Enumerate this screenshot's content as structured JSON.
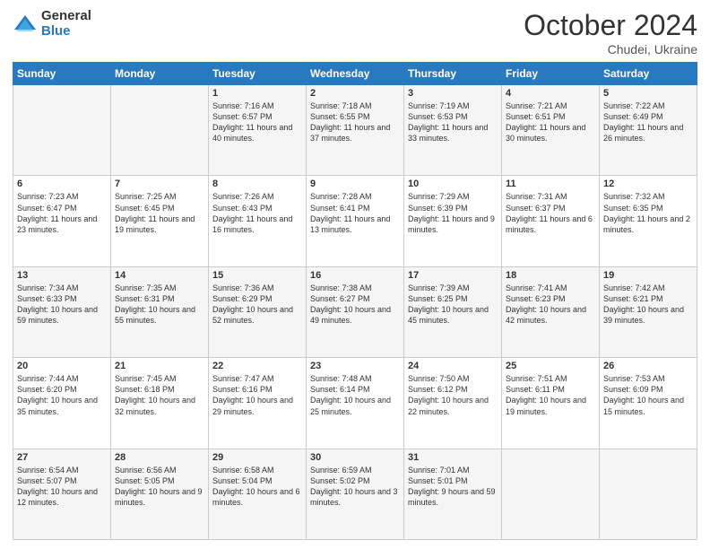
{
  "logo": {
    "general": "General",
    "blue": "Blue"
  },
  "header": {
    "month": "October 2024",
    "location": "Chudei, Ukraine"
  },
  "days_of_week": [
    "Sunday",
    "Monday",
    "Tuesday",
    "Wednesday",
    "Thursday",
    "Friday",
    "Saturday"
  ],
  "weeks": [
    [
      {
        "day": "",
        "info": ""
      },
      {
        "day": "",
        "info": ""
      },
      {
        "day": "1",
        "info": "Sunrise: 7:16 AM\nSunset: 6:57 PM\nDaylight: 11 hours and 40 minutes."
      },
      {
        "day": "2",
        "info": "Sunrise: 7:18 AM\nSunset: 6:55 PM\nDaylight: 11 hours and 37 minutes."
      },
      {
        "day": "3",
        "info": "Sunrise: 7:19 AM\nSunset: 6:53 PM\nDaylight: 11 hours and 33 minutes."
      },
      {
        "day": "4",
        "info": "Sunrise: 7:21 AM\nSunset: 6:51 PM\nDaylight: 11 hours and 30 minutes."
      },
      {
        "day": "5",
        "info": "Sunrise: 7:22 AM\nSunset: 6:49 PM\nDaylight: 11 hours and 26 minutes."
      }
    ],
    [
      {
        "day": "6",
        "info": "Sunrise: 7:23 AM\nSunset: 6:47 PM\nDaylight: 11 hours and 23 minutes."
      },
      {
        "day": "7",
        "info": "Sunrise: 7:25 AM\nSunset: 6:45 PM\nDaylight: 11 hours and 19 minutes."
      },
      {
        "day": "8",
        "info": "Sunrise: 7:26 AM\nSunset: 6:43 PM\nDaylight: 11 hours and 16 minutes."
      },
      {
        "day": "9",
        "info": "Sunrise: 7:28 AM\nSunset: 6:41 PM\nDaylight: 11 hours and 13 minutes."
      },
      {
        "day": "10",
        "info": "Sunrise: 7:29 AM\nSunset: 6:39 PM\nDaylight: 11 hours and 9 minutes."
      },
      {
        "day": "11",
        "info": "Sunrise: 7:31 AM\nSunset: 6:37 PM\nDaylight: 11 hours and 6 minutes."
      },
      {
        "day": "12",
        "info": "Sunrise: 7:32 AM\nSunset: 6:35 PM\nDaylight: 11 hours and 2 minutes."
      }
    ],
    [
      {
        "day": "13",
        "info": "Sunrise: 7:34 AM\nSunset: 6:33 PM\nDaylight: 10 hours and 59 minutes."
      },
      {
        "day": "14",
        "info": "Sunrise: 7:35 AM\nSunset: 6:31 PM\nDaylight: 10 hours and 55 minutes."
      },
      {
        "day": "15",
        "info": "Sunrise: 7:36 AM\nSunset: 6:29 PM\nDaylight: 10 hours and 52 minutes."
      },
      {
        "day": "16",
        "info": "Sunrise: 7:38 AM\nSunset: 6:27 PM\nDaylight: 10 hours and 49 minutes."
      },
      {
        "day": "17",
        "info": "Sunrise: 7:39 AM\nSunset: 6:25 PM\nDaylight: 10 hours and 45 minutes."
      },
      {
        "day": "18",
        "info": "Sunrise: 7:41 AM\nSunset: 6:23 PM\nDaylight: 10 hours and 42 minutes."
      },
      {
        "day": "19",
        "info": "Sunrise: 7:42 AM\nSunset: 6:21 PM\nDaylight: 10 hours and 39 minutes."
      }
    ],
    [
      {
        "day": "20",
        "info": "Sunrise: 7:44 AM\nSunset: 6:20 PM\nDaylight: 10 hours and 35 minutes."
      },
      {
        "day": "21",
        "info": "Sunrise: 7:45 AM\nSunset: 6:18 PM\nDaylight: 10 hours and 32 minutes."
      },
      {
        "day": "22",
        "info": "Sunrise: 7:47 AM\nSunset: 6:16 PM\nDaylight: 10 hours and 29 minutes."
      },
      {
        "day": "23",
        "info": "Sunrise: 7:48 AM\nSunset: 6:14 PM\nDaylight: 10 hours and 25 minutes."
      },
      {
        "day": "24",
        "info": "Sunrise: 7:50 AM\nSunset: 6:12 PM\nDaylight: 10 hours and 22 minutes."
      },
      {
        "day": "25",
        "info": "Sunrise: 7:51 AM\nSunset: 6:11 PM\nDaylight: 10 hours and 19 minutes."
      },
      {
        "day": "26",
        "info": "Sunrise: 7:53 AM\nSunset: 6:09 PM\nDaylight: 10 hours and 15 minutes."
      }
    ],
    [
      {
        "day": "27",
        "info": "Sunrise: 6:54 AM\nSunset: 5:07 PM\nDaylight: 10 hours and 12 minutes."
      },
      {
        "day": "28",
        "info": "Sunrise: 6:56 AM\nSunset: 5:05 PM\nDaylight: 10 hours and 9 minutes."
      },
      {
        "day": "29",
        "info": "Sunrise: 6:58 AM\nSunset: 5:04 PM\nDaylight: 10 hours and 6 minutes."
      },
      {
        "day": "30",
        "info": "Sunrise: 6:59 AM\nSunset: 5:02 PM\nDaylight: 10 hours and 3 minutes."
      },
      {
        "day": "31",
        "info": "Sunrise: 7:01 AM\nSunset: 5:01 PM\nDaylight: 9 hours and 59 minutes."
      },
      {
        "day": "",
        "info": ""
      },
      {
        "day": "",
        "info": ""
      }
    ]
  ]
}
